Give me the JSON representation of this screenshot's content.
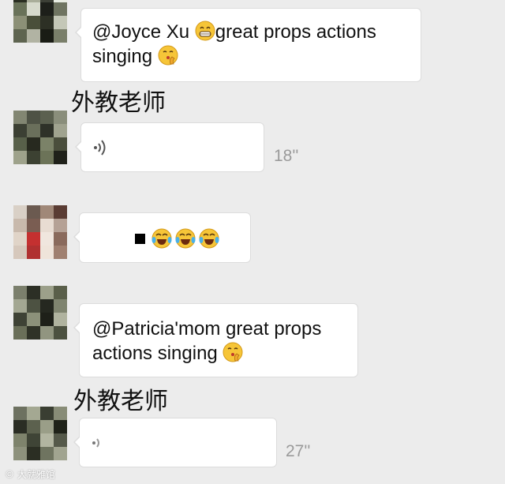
{
  "messages": [
    {
      "type": "text",
      "text": "@Joyce Xu ",
      "text_after_emoji": "great props actions",
      "line2": "singing "
    },
    {
      "type": "voice",
      "sender": "外教老师",
      "duration": "18''"
    },
    {
      "type": "emoji_reply"
    },
    {
      "type": "text",
      "line1": "@Patricia'mom great props",
      "line2": "actions singing "
    },
    {
      "type": "voice",
      "sender": "外教老师",
      "duration": "27''"
    }
  ],
  "watermark": "大就雅馆",
  "icons": {
    "grin": "grinning-face-icon",
    "hush": "shushing-face-icon",
    "laugh": "tears-of-joy-face-icon",
    "voice": "voice-wave-icon"
  },
  "colors": {
    "background": "#ececec",
    "bubble": "#ffffff",
    "emoji_yellow": "#f6c538",
    "duration_gray": "#9a9a9a"
  }
}
